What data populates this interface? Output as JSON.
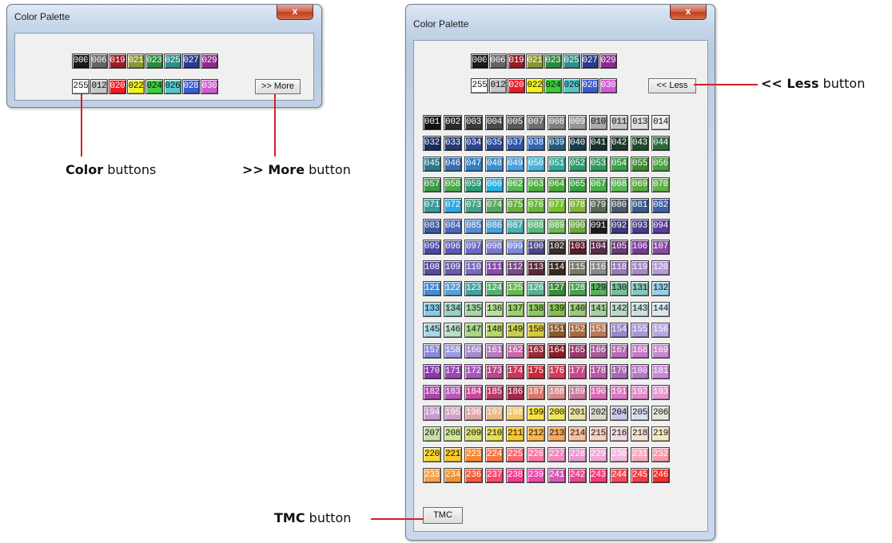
{
  "small_window": {
    "title": "Color Palette",
    "close_label": "x",
    "row1": [
      {
        "code": "000",
        "color": "#1c1c1c",
        "dark": true
      },
      {
        "code": "006",
        "color": "#646464",
        "dark": true
      },
      {
        "code": "019",
        "color": "#9b1c24",
        "dark": true
      },
      {
        "code": "021",
        "color": "#8c9632",
        "dark": true
      },
      {
        "code": "023",
        "color": "#2a8a3c",
        "dark": true
      },
      {
        "code": "025",
        "color": "#2f8f8a",
        "dark": true
      },
      {
        "code": "027",
        "color": "#2b3a8c",
        "dark": true
      },
      {
        "code": "029",
        "color": "#8e2a8e",
        "dark": true
      }
    ],
    "row2": [
      {
        "code": "255",
        "color": "#ffffff",
        "dark": false
      },
      {
        "code": "012",
        "color": "#c8c8c8",
        "dark": false
      },
      {
        "code": "020",
        "color": "#ee1c24",
        "dark": true
      },
      {
        "code": "022",
        "color": "#f2f21c",
        "dark": false
      },
      {
        "code": "024",
        "color": "#3ccc3c",
        "dark": false
      },
      {
        "code": "026",
        "color": "#54c8c8",
        "dark": false
      },
      {
        "code": "028",
        "color": "#3c5cd0",
        "dark": true
      },
      {
        "code": "030",
        "color": "#d05cd0",
        "dark": true
      }
    ],
    "more_label": ">> More"
  },
  "large_window": {
    "title": "Color Palette",
    "close_label": "x",
    "row1": [
      {
        "code": "000",
        "color": "#1c1c1c",
        "dark": true
      },
      {
        "code": "006",
        "color": "#646464",
        "dark": true
      },
      {
        "code": "019",
        "color": "#9b1c24",
        "dark": true
      },
      {
        "code": "021",
        "color": "#8c9632",
        "dark": true
      },
      {
        "code": "023",
        "color": "#2a8a3c",
        "dark": true
      },
      {
        "code": "025",
        "color": "#2f8f8a",
        "dark": true
      },
      {
        "code": "027",
        "color": "#2b3a8c",
        "dark": true
      },
      {
        "code": "029",
        "color": "#8e2a8e",
        "dark": true
      }
    ],
    "row2": [
      {
        "code": "255",
        "color": "#ffffff",
        "dark": false
      },
      {
        "code": "012",
        "color": "#c8c8c8",
        "dark": false
      },
      {
        "code": "020",
        "color": "#ee1c24",
        "dark": true
      },
      {
        "code": "022",
        "color": "#f2f21c",
        "dark": false
      },
      {
        "code": "024",
        "color": "#3ccc3c",
        "dark": false
      },
      {
        "code": "026",
        "color": "#54c8c8",
        "dark": false
      },
      {
        "code": "028",
        "color": "#3c5cd0",
        "dark": true
      },
      {
        "code": "030",
        "color": "#d05cd0",
        "dark": true
      }
    ],
    "less_label": "<< Less",
    "tmc_label": "TMC",
    "grid": [
      [
        [
          "001",
          "#111111",
          1
        ],
        [
          "002",
          "#2a2a2a",
          1
        ],
        [
          "003",
          "#3a3a3a",
          1
        ],
        [
          "004",
          "#4a4a4a",
          1
        ],
        [
          "005",
          "#5a5a5a",
          1
        ],
        [
          "007",
          "#6e6e6e",
          1
        ],
        [
          "008",
          "#808080",
          1
        ],
        [
          "009",
          "#969696",
          1
        ],
        [
          "010",
          "#aaaaaa",
          0
        ],
        [
          "011",
          "#c4c4c4",
          0
        ],
        [
          "013",
          "#dcdcdc",
          0
        ],
        [
          "014",
          "#ececec",
          0
        ]
      ],
      [
        [
          "032",
          "#1d2a5e",
          1
        ],
        [
          "033",
          "#243a78",
          1
        ],
        [
          "034",
          "#2c4690",
          1
        ],
        [
          "035",
          "#2a4c9a",
          1
        ],
        [
          "037",
          "#2e56a8",
          1
        ],
        [
          "038",
          "#3164b4",
          1
        ],
        [
          "039",
          "#235c82",
          1
        ],
        [
          "040",
          "#1b3e4a",
          1
        ],
        [
          "041",
          "#17312c",
          1
        ],
        [
          "042",
          "#1c3a2a",
          1
        ],
        [
          "043",
          "#1f4a2c",
          1
        ],
        [
          "044",
          "#2a6a3a",
          1
        ]
      ],
      [
        [
          "045",
          "#2a7a8a",
          1
        ],
        [
          "046",
          "#3a6cb0",
          1
        ],
        [
          "047",
          "#2f80c4",
          1
        ],
        [
          "048",
          "#3a8fd0",
          1
        ],
        [
          "049",
          "#4aa0e0",
          1
        ],
        [
          "050",
          "#4ab4d8",
          1
        ],
        [
          "051",
          "#2faa98",
          1
        ],
        [
          "052",
          "#2d9a6a",
          1
        ],
        [
          "053",
          "#2e9a58",
          1
        ],
        [
          "054",
          "#3aa04a",
          1
        ],
        [
          "055",
          "#3e8a30",
          1
        ],
        [
          "056",
          "#48a040",
          1
        ]
      ],
      [
        [
          "057",
          "#3a9a48",
          1
        ],
        [
          "058",
          "#4aa84a",
          1
        ],
        [
          "059",
          "#2f9a7a",
          1
        ],
        [
          "060",
          "#28b0e0",
          1
        ],
        [
          "062",
          "#58b858",
          1
        ],
        [
          "063",
          "#52b040",
          1
        ],
        [
          "064",
          "#4aa838",
          1
        ],
        [
          "065",
          "#3aa040",
          1
        ],
        [
          "067",
          "#48b048",
          1
        ],
        [
          "068",
          "#58b858",
          1
        ],
        [
          "069",
          "#5aa840",
          1
        ],
        [
          "070",
          "#62b048",
          1
        ]
      ],
      [
        [
          "071",
          "#3a9a9a",
          1
        ],
        [
          "072",
          "#2ea8e0",
          1
        ],
        [
          "073",
          "#44a48a",
          1
        ],
        [
          "074",
          "#5aa860",
          1
        ],
        [
          "075",
          "#68b040",
          1
        ],
        [
          "076",
          "#6ab838",
          1
        ],
        [
          "077",
          "#78c030",
          1
        ],
        [
          "078",
          "#80b838",
          1
        ],
        [
          "079",
          "#5a6a58",
          1
        ],
        [
          "080",
          "#4a5a6a",
          1
        ],
        [
          "081",
          "#3a5a8a",
          1
        ],
        [
          "082",
          "#3e60a8",
          1
        ]
      ],
      [
        [
          "083",
          "#3a5aa0",
          1
        ],
        [
          "084",
          "#4a6ab8",
          1
        ],
        [
          "085",
          "#5a8ad0",
          1
        ],
        [
          "086",
          "#4aa0d8",
          1
        ],
        [
          "087",
          "#4ab0b0",
          1
        ],
        [
          "088",
          "#58b878",
          1
        ],
        [
          "089",
          "#6ab858",
          1
        ],
        [
          "090",
          "#6aa840",
          1
        ],
        [
          "091",
          "#1c1c1c",
          1
        ],
        [
          "092",
          "#3a3a7a",
          1
        ],
        [
          "093",
          "#4a3a8a",
          1
        ],
        [
          "094",
          "#5a3a9a",
          1
        ]
      ],
      [
        [
          "095",
          "#4a4aa8",
          1
        ],
        [
          "096",
          "#5a5ab8",
          1
        ],
        [
          "097",
          "#6a6ac8",
          1
        ],
        [
          "098",
          "#7a7ad0",
          1
        ],
        [
          "099",
          "#7a8ad8",
          1
        ],
        [
          "100",
          "#4a4a8a",
          1
        ],
        [
          "102",
          "#3a2a2a",
          1
        ],
        [
          "103",
          "#5a1c2a",
          1
        ],
        [
          "104",
          "#5a2a4a",
          1
        ],
        [
          "105",
          "#6a3a7a",
          1
        ],
        [
          "106",
          "#7a3a9a",
          1
        ],
        [
          "107",
          "#8a4aa8",
          1
        ]
      ],
      [
        [
          "108",
          "#5a4aa0",
          1
        ],
        [
          "109",
          "#6a5ab0",
          1
        ],
        [
          "110",
          "#7a6ac0",
          1
        ],
        [
          "111",
          "#8a4ab0",
          1
        ],
        [
          "112",
          "#7a4a8a",
          1
        ],
        [
          "113",
          "#5a2a3a",
          1
        ],
        [
          "114",
          "#3a2a1c",
          1
        ],
        [
          "115",
          "#7a7a6a",
          1
        ],
        [
          "116",
          "#8a8a8a",
          1
        ],
        [
          "118",
          "#9a7ab8",
          1
        ],
        [
          "119",
          "#a888c8",
          1
        ],
        [
          "120",
          "#b898d8",
          1
        ]
      ],
      [
        [
          "121",
          "#4a8ad0",
          1
        ],
        [
          "122",
          "#58a0d8",
          1
        ],
        [
          "123",
          "#48a0a0",
          1
        ],
        [
          "124",
          "#58b070",
          1
        ],
        [
          "125",
          "#68b850",
          1
        ],
        [
          "126",
          "#5ab090",
          1
        ],
        [
          "127",
          "#3a8a3a",
          1
        ],
        [
          "128",
          "#48a050",
          1
        ],
        [
          "129",
          "#58b060",
          0
        ],
        [
          "130",
          "#78c0a0",
          0
        ],
        [
          "131",
          "#88c8c0",
          0
        ],
        [
          "132",
          "#98d0e8",
          0
        ]
      ],
      [
        [
          "133",
          "#88c8e8",
          0
        ],
        [
          "134",
          "#98d0c8",
          0
        ],
        [
          "135",
          "#a8d8a8",
          0
        ],
        [
          "136",
          "#b8e098",
          0
        ],
        [
          "137",
          "#a0d070",
          0
        ],
        [
          "138",
          "#90c860",
          0
        ],
        [
          "139",
          "#80c050",
          0
        ],
        [
          "140",
          "#98c878",
          0
        ],
        [
          "141",
          "#a8d0a0",
          0
        ],
        [
          "142",
          "#b8d8c8",
          0
        ],
        [
          "143",
          "#c8e0e0",
          0
        ],
        [
          "144",
          "#d8e8f0",
          0
        ]
      ],
      [
        [
          "145",
          "#a8d8e0",
          0
        ],
        [
          "146",
          "#b8e0c8",
          0
        ],
        [
          "147",
          "#a8d888",
          0
        ],
        [
          "148",
          "#b8d868",
          0
        ],
        [
          "149",
          "#c8d050",
          0
        ],
        [
          "150",
          "#d8c838",
          0
        ],
        [
          "151",
          "#8a5a28",
          1
        ],
        [
          "152",
          "#a86a40",
          1
        ],
        [
          "153",
          "#b87a58",
          1
        ],
        [
          "154",
          "#9a88c8",
          1
        ],
        [
          "155",
          "#a898d8",
          1
        ],
        [
          "156",
          "#b8a8e0",
          1
        ]
      ],
      [
        [
          "157",
          "#8a8ad8",
          1
        ],
        [
          "158",
          "#9a9ae0",
          1
        ],
        [
          "160",
          "#a88ad0",
          1
        ],
        [
          "161",
          "#b87ac0",
          1
        ],
        [
          "162",
          "#c86aa8",
          1
        ],
        [
          "163",
          "#9a2a3a",
          1
        ],
        [
          "164",
          "#8a1c2a",
          1
        ],
        [
          "165",
          "#9a3a6a",
          1
        ],
        [
          "166",
          "#a85a9a",
          1
        ],
        [
          "167",
          "#b86ab8",
          1
        ],
        [
          "168",
          "#c87ac8",
          1
        ],
        [
          "169",
          "#c888d0",
          1
        ]
      ],
      [
        [
          "170",
          "#8a3aa8",
          1
        ],
        [
          "171",
          "#9a48b8",
          1
        ],
        [
          "172",
          "#a858c0",
          1
        ],
        [
          "173",
          "#b8488a",
          1
        ],
        [
          "174",
          "#c8385a",
          1
        ],
        [
          "175",
          "#c82a3a",
          1
        ],
        [
          "176",
          "#d83a5a",
          1
        ],
        [
          "177",
          "#c8488a",
          1
        ],
        [
          "178",
          "#b858a8",
          1
        ],
        [
          "179",
          "#a868b8",
          1
        ],
        [
          "180",
          "#b878c8",
          1
        ],
        [
          "181",
          "#c888d8",
          1
        ]
      ],
      [
        [
          "182",
          "#a848a8",
          1
        ],
        [
          "183",
          "#b858b8",
          1
        ],
        [
          "184",
          "#c8489a",
          1
        ],
        [
          "185",
          "#b83a6a",
          1
        ],
        [
          "186",
          "#a82a4a",
          1
        ],
        [
          "187",
          "#d87a6a",
          1
        ],
        [
          "188",
          "#d88a8a",
          1
        ],
        [
          "189",
          "#c87a9a",
          1
        ],
        [
          "190",
          "#d86ab0",
          1
        ],
        [
          "191",
          "#d878c0",
          1
        ],
        [
          "192",
          "#e088c8",
          1
        ],
        [
          "193",
          "#e898d0",
          1
        ]
      ],
      [
        [
          "194",
          "#c898d0",
          1
        ],
        [
          "195",
          "#d8a0c8",
          1
        ],
        [
          "196",
          "#e0a8a8",
          1
        ],
        [
          "197",
          "#e8b888",
          1
        ],
        [
          "198",
          "#f0c868",
          1
        ],
        [
          "199",
          "#f8e040",
          0
        ],
        [
          "200",
          "#f0e858",
          0
        ],
        [
          "201",
          "#e8e0a0",
          0
        ],
        [
          "202",
          "#d8d8c8",
          0
        ],
        [
          "204",
          "#c8c8e8",
          0
        ],
        [
          "205",
          "#d8e0f0",
          0
        ],
        [
          "206",
          "#e0e8d8",
          0
        ]
      ],
      [
        [
          "207",
          "#c8e0a8",
          0
        ],
        [
          "208",
          "#d0e890",
          0
        ],
        [
          "209",
          "#d8e070",
          0
        ],
        [
          "210",
          "#e8e050",
          0
        ],
        [
          "211",
          "#f8c830",
          0
        ],
        [
          "212",
          "#f8b848",
          0
        ],
        [
          "213",
          "#f8a860",
          0
        ],
        [
          "214",
          "#f8c0a0",
          0
        ],
        [
          "215",
          "#f8d0c0",
          0
        ],
        [
          "216",
          "#f0d8e0",
          0
        ],
        [
          "218",
          "#f8e0d0",
          0
        ],
        [
          "219",
          "#f8e8c0",
          0
        ]
      ],
      [
        [
          "220",
          "#f8d830",
          0
        ],
        [
          "221",
          "#f8c828",
          0
        ],
        [
          "223",
          "#f88830",
          1
        ],
        [
          "224",
          "#f87848",
          1
        ],
        [
          "225",
          "#f86870",
          1
        ],
        [
          "226",
          "#f878a0",
          1
        ],
        [
          "227",
          "#f088c0",
          1
        ],
        [
          "228",
          "#e898d0",
          1
        ],
        [
          "229",
          "#f0a8d8",
          1
        ],
        [
          "230",
          "#f8b8e0",
          1
        ],
        [
          "231",
          "#f8a8c0",
          1
        ],
        [
          "232",
          "#f898a8",
          1
        ]
      ],
      [
        [
          "233",
          "#f8a048",
          1
        ],
        [
          "234",
          "#f89030",
          1
        ],
        [
          "236",
          "#f85838",
          1
        ],
        [
          "237",
          "#f84870",
          1
        ],
        [
          "238",
          "#f83890",
          1
        ],
        [
          "239",
          "#e848a8",
          1
        ],
        [
          "241",
          "#d858b8",
          1
        ],
        [
          "242",
          "#e84890",
          1
        ],
        [
          "243",
          "#f83878",
          1
        ],
        [
          "244",
          "#f84858",
          1
        ],
        [
          "245",
          "#f83a40",
          1
        ],
        [
          "246",
          "#f82a2a",
          1
        ]
      ]
    ]
  },
  "annotations": {
    "color_bold": "Color",
    "color_rest": " buttons",
    "more_bold": ">> More",
    "more_rest": " button",
    "less_bold": "<< Less",
    "less_rest": " button",
    "tmc_bold": "TMC",
    "tmc_rest": " button"
  }
}
